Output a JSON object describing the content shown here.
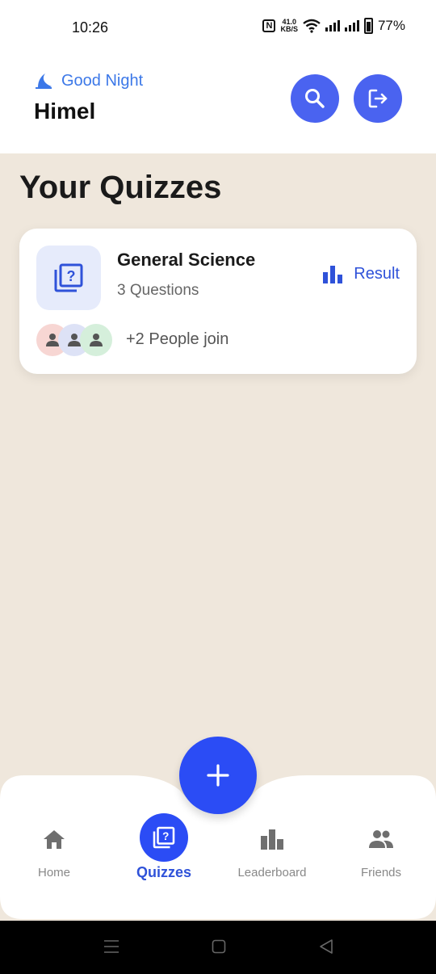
{
  "status_bar": {
    "time": "10:26",
    "net_speed_value": "41.0",
    "net_speed_unit": "KB/S",
    "battery": "77%"
  },
  "header": {
    "greeting": "Good Night",
    "username": "Himel",
    "greeting_icon": "moon-icon",
    "search_icon": "search-icon",
    "logout_icon": "logout-icon"
  },
  "main": {
    "section_title": "Your Quizzes",
    "quizzes": [
      {
        "title": "General Science",
        "questions": "3 Questions",
        "result_label": "Result",
        "join_text": "+2 People join"
      }
    ]
  },
  "bottom_nav": {
    "items": [
      {
        "label": "Home",
        "icon": "home-icon"
      },
      {
        "label": "Quizzes",
        "icon": "quiz-icon",
        "active": true
      },
      {
        "label": "Leaderboard",
        "icon": "leaderboard-icon"
      },
      {
        "label": "Friends",
        "icon": "friends-icon"
      }
    ],
    "fab_icon": "plus-icon"
  },
  "colors": {
    "accent": "#2b4cf5",
    "header_button": "#4a63f0",
    "background": "#efe7dc",
    "greeting": "#3c78e8"
  }
}
